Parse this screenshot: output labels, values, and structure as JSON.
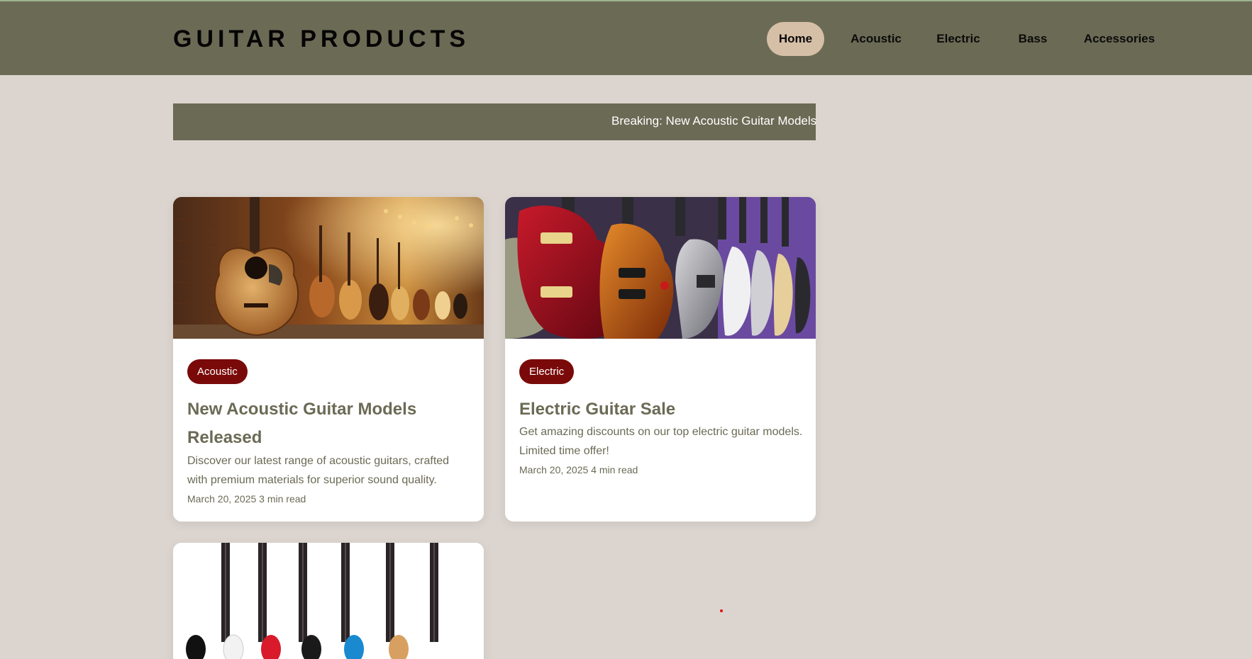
{
  "header": {
    "brand": "GUITAR PRODUCTS",
    "nav": [
      {
        "label": "Home",
        "active": true
      },
      {
        "label": "Acoustic",
        "active": false
      },
      {
        "label": "Electric",
        "active": false
      },
      {
        "label": "Bass",
        "active": false
      },
      {
        "label": "Accessories",
        "active": false
      }
    ]
  },
  "ticker": {
    "text": "Breaking: New Acoustic Guitar Models Released"
  },
  "cards": [
    {
      "badge": "Acoustic",
      "title": "New Acoustic Guitar Models Released",
      "description": "Discover our latest range of acoustic guitars, crafted with premium materials for superior sound quality.",
      "meta": "March 20, 2025 3 min read",
      "image": "acoustic-guitar-shop-photo"
    },
    {
      "badge": "Electric",
      "title": "Electric Guitar Sale",
      "description": "Get amazing discounts on our top electric guitar models. Limited time offer!",
      "meta": "March 20, 2025 4 min read",
      "image": "electric-guitars-rack-photo"
    },
    {
      "image": "bass-guitars-row-photo"
    }
  ],
  "colors": {
    "background": "#dcd5cf",
    "header": "#6b6a55",
    "accent": "#d5bfa6",
    "badge": "#7a0a0a"
  }
}
